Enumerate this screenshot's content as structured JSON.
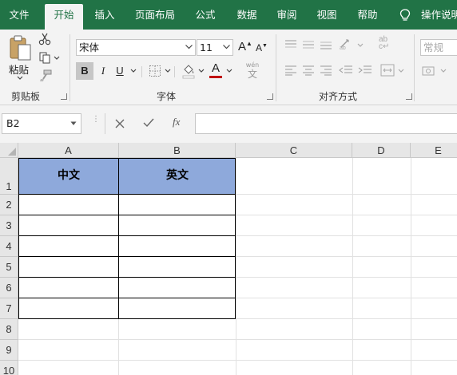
{
  "ribbon_tabs": {
    "file": "文件",
    "home": "开始",
    "insert": "插入",
    "page_layout": "页面布局",
    "formulas": "公式",
    "data": "数据",
    "review": "审阅",
    "view": "视图",
    "help": "帮助",
    "tell_me": "操作说明"
  },
  "clipboard": {
    "paste_label": "粘贴",
    "group_label": "剪贴板"
  },
  "font": {
    "name": "宋体",
    "size": "11",
    "bold_label": "B",
    "italic_label": "I",
    "underline_label": "U",
    "font_color_letter": "A",
    "font_color": "#c00000",
    "phonetic_glyph": "文",
    "phonetic_small": "wén",
    "grow_label": "A",
    "shrink_label": "A",
    "group_label": "字体"
  },
  "alignment": {
    "group_label": "对齐方式",
    "wrap_glyph": "ab",
    "wrap_glyph2": "c"
  },
  "number": {
    "format": "常规"
  },
  "formula_bar": {
    "name_box": "B2",
    "fx_label": "fx",
    "formula": ""
  },
  "sheet": {
    "columns": [
      "A",
      "B",
      "C",
      "D",
      "E"
    ],
    "rows": [
      "1",
      "2",
      "3",
      "4",
      "5",
      "6",
      "7",
      "8",
      "9",
      "10"
    ],
    "header_fill": "#8ea9db",
    "cells": {
      "A1": "中文",
      "B1": "英文"
    }
  }
}
